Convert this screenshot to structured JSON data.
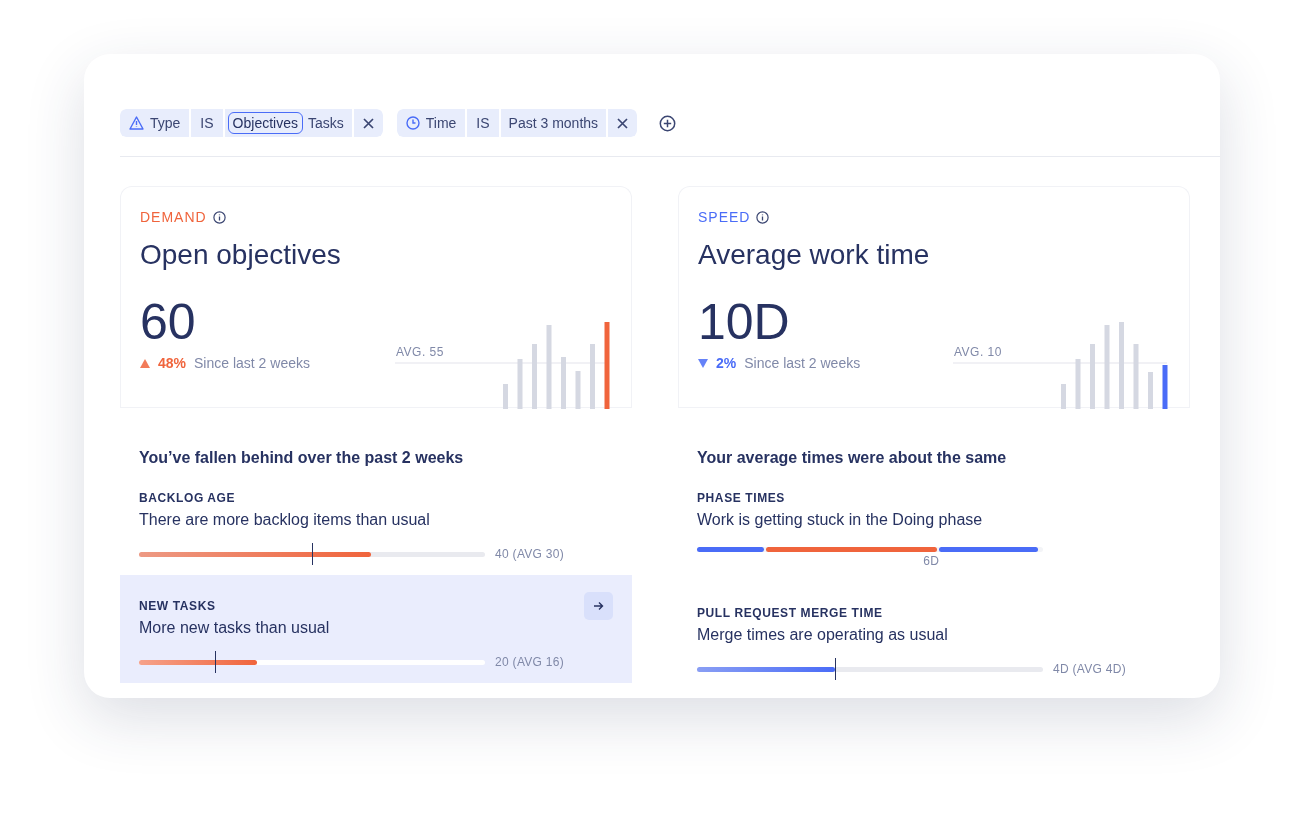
{
  "filters": [
    {
      "field": "Type",
      "operator": "IS",
      "values": [
        {
          "label": "Objectives",
          "selected": true
        },
        {
          "label": "Tasks",
          "selected": false
        }
      ]
    },
    {
      "field": "Time",
      "operator": "IS",
      "values": [
        {
          "label": "Past 3 months",
          "selected": false
        }
      ]
    }
  ],
  "cards": [
    {
      "category": "DEMAND",
      "color": "#f0643c",
      "title": "Open objectives",
      "value": "60",
      "trend": {
        "kind": "up",
        "percent": "48%",
        "caption": "Since last 2 weeks"
      },
      "avg_label": "AVG. 55",
      "headline": "You’ve fallen behind over the past 2 weeks",
      "metrics": [
        {
          "kind": "bar",
          "label": "BACKLOG AGE",
          "description": "There are more backlog items than usual",
          "level": 0.67,
          "avg_marker": {
            "level": 0.5
          },
          "reading": "40 (AVG 30)",
          "selected": false
        },
        {
          "kind": "bar",
          "label": "NEW TASKS",
          "description": "More new tasks than usual",
          "level": 0.34,
          "avg_marker": {
            "level": 0.22
          },
          "reading": "20 (AVG 16)",
          "selected": true
        }
      ]
    },
    {
      "category": "SPEED",
      "color": "#4a6cf7",
      "title": "Average work time",
      "value": "10D",
      "trend": {
        "kind": "down",
        "percent": "2%",
        "caption": "Since last 2 weeks"
      },
      "avg_label": "AVG. 10",
      "headline": "Your average times were about the same",
      "metrics": [
        {
          "kind": "phases",
          "label": "PHASE TIMES",
          "description": "Work is getting stuck in the Doing phase",
          "segments": [
            {
              "level": 0.2,
              "color": "#4a6cf7"
            },
            {
              "level": 0.5,
              "color": "#f0643c"
            },
            {
              "level": 0.29,
              "color": "#4a6cf7"
            }
          ],
          "reading": "6D",
          "selected": false
        },
        {
          "kind": "bar",
          "label": "PULL REQUEST MERGE TIME",
          "description": "Merge times are operating as usual",
          "level": 0.4,
          "avg_marker": {
            "level": 0.4
          },
          "reading": "4D (AVG 4D)",
          "selected": false
        }
      ]
    }
  ]
}
